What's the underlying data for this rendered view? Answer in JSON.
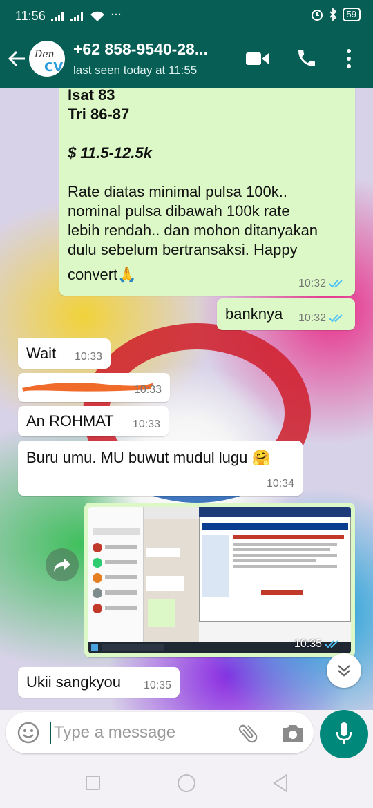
{
  "status_bar": {
    "time": "11:56",
    "more": "···",
    "battery": "59"
  },
  "header": {
    "contact_name": "+62 858-9540-28...",
    "contact_status": "last seen today at 11:55",
    "avatar_text": "Den CV",
    "icons": [
      "back-arrow-icon",
      "video-call-icon",
      "voice-call-icon",
      "more-vert-icon"
    ]
  },
  "messages": [
    {
      "direction": "out",
      "lines": [
        "Isat 83",
        "Tri 86-87",
        "$ 11.5-12.5k",
        "Rate diatas minimal pulsa 100k..",
        "nominal pulsa dibawah 100k rate",
        "lebih rendah.. dan mohon ditanyakan",
        "dulu sebelum bertransaksi. Happy",
        "convert🙏"
      ],
      "time": "10:32"
    },
    {
      "direction": "out",
      "text": "banknya",
      "time": "10:32"
    },
    {
      "direction": "in",
      "text": "Wait",
      "time": "10:33"
    },
    {
      "direction": "in",
      "text": "",
      "time": "10:33"
    },
    {
      "direction": "in",
      "text": "An ROHMAT",
      "time": "10:33"
    },
    {
      "direction": "in",
      "text": "Buru umu. MU buwut mudul lugu 🤗",
      "time": "10:34"
    },
    {
      "direction": "out",
      "type": "image",
      "time": "10:35"
    },
    {
      "direction": "in",
      "text": "Ukii sangkyou",
      "time": "10:35"
    }
  ],
  "composer": {
    "placeholder": "Type a message"
  },
  "colors": {
    "header": "#075e54",
    "outgoing_bubble": "#dcf8c6",
    "incoming_bubble": "#ffffff",
    "read_ticks": "#4fc3f7",
    "mic_button": "#00897b",
    "redaction": "#f06a2a"
  }
}
